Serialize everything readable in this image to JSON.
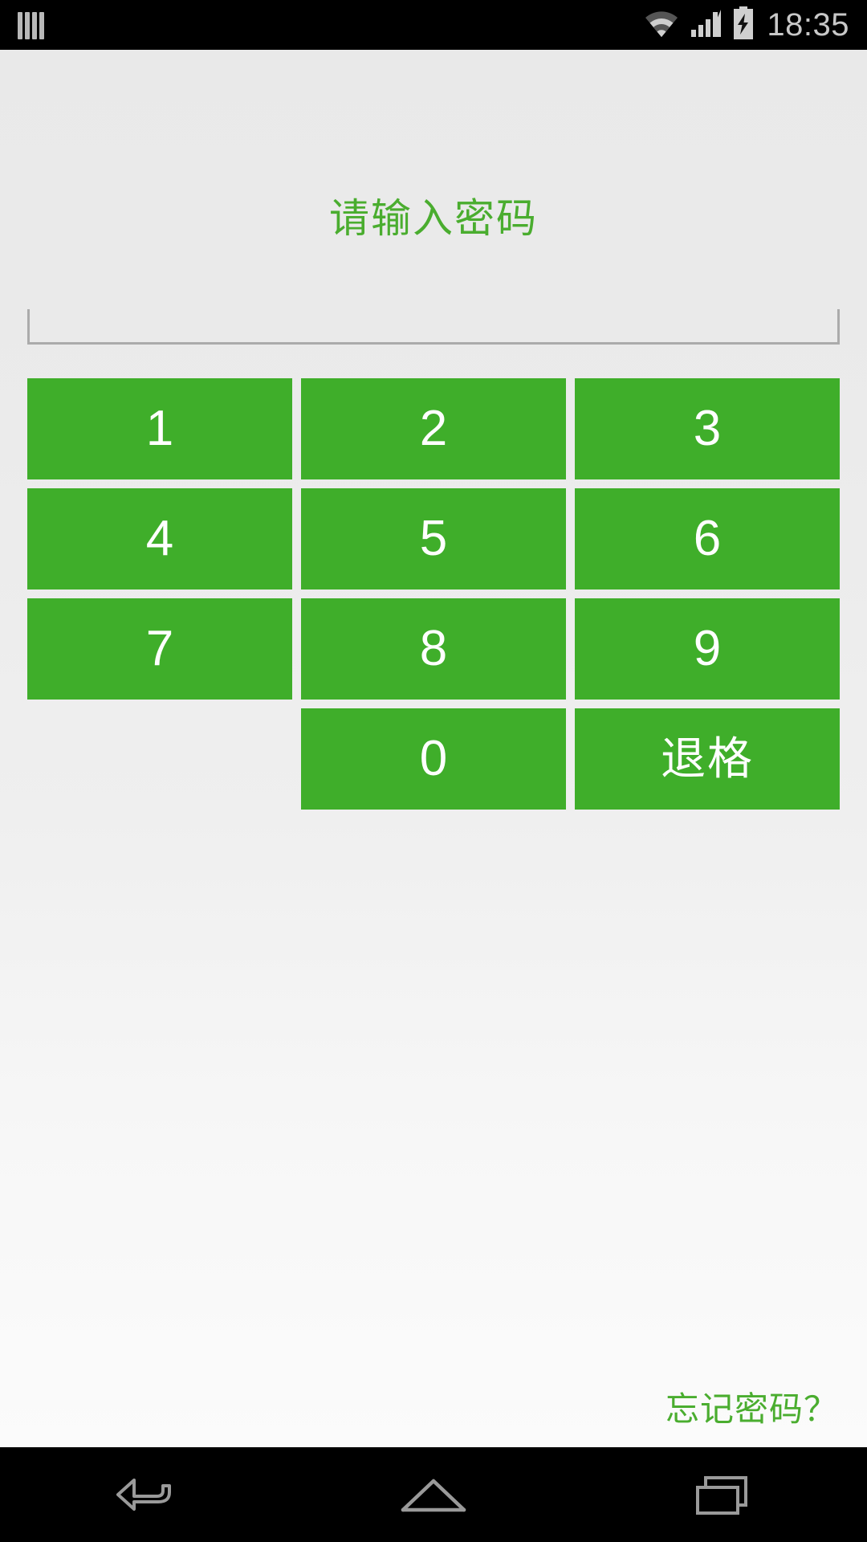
{
  "status_bar": {
    "notification_icon": "bars-notification-icon",
    "wifi_icon": "wifi-icon",
    "signal_icon": "cellular-signal-icon",
    "battery_icon": "battery-charging-icon",
    "time": "18:35"
  },
  "screen": {
    "title": "请输入密码",
    "password": {
      "value": "",
      "placeholder": ""
    },
    "keypad": [
      {
        "label": "1",
        "name": "key-1"
      },
      {
        "label": "2",
        "name": "key-2"
      },
      {
        "label": "3",
        "name": "key-3"
      },
      {
        "label": "4",
        "name": "key-4"
      },
      {
        "label": "5",
        "name": "key-5"
      },
      {
        "label": "6",
        "name": "key-6"
      },
      {
        "label": "7",
        "name": "key-7"
      },
      {
        "label": "8",
        "name": "key-8"
      },
      {
        "label": "9",
        "name": "key-9"
      },
      {
        "label": "",
        "name": "key-blank"
      },
      {
        "label": "0",
        "name": "key-0"
      },
      {
        "label": "退格",
        "name": "key-backspace"
      }
    ],
    "forgot_password": "忘记密码？"
  },
  "nav_bar": {
    "back": "back-icon",
    "home": "home-icon",
    "recents": "recents-icon"
  },
  "colors": {
    "key_green": "#3fae2a",
    "text_green": "#4aad2f",
    "status_bar_bg": "#000000",
    "content_bg": "#ededed",
    "input_underline": "#ababab"
  }
}
